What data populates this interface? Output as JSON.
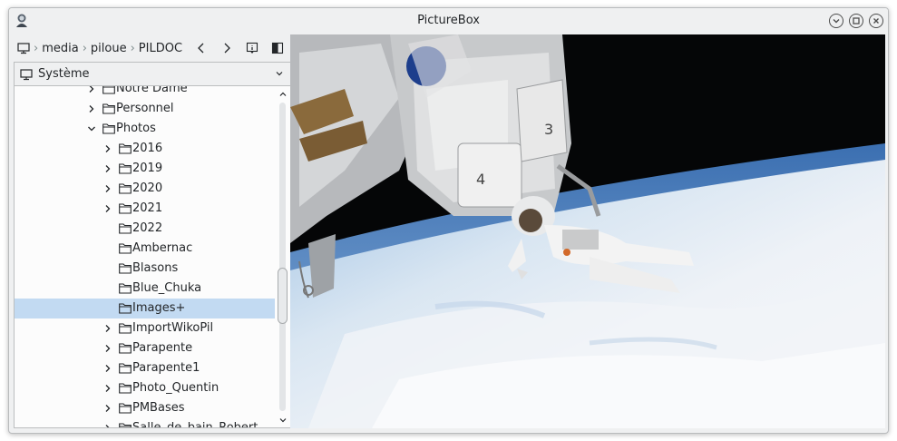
{
  "window": {
    "title": "PictureBox"
  },
  "icons": {
    "app": "astronaut-app-icon",
    "minimize": "chevron-down-icon",
    "maximize": "square-icon",
    "close": "x-icon"
  },
  "pathbar": {
    "crumbs": [
      "media",
      "piloue",
      "PILDOC"
    ],
    "back_icon": "chevron-left-icon",
    "forward_icon": "chevron-right-icon",
    "info_icon": "info-icon",
    "columns_icon": "two-columns-icon"
  },
  "location": {
    "label": "Système"
  },
  "tree": {
    "items": [
      {
        "label": "Notre Dame",
        "arrow": "right"
      },
      {
        "label": "Personnel",
        "arrow": "right"
      },
      {
        "label": "Photos",
        "arrow": "down"
      },
      {
        "label": "2016",
        "arrow": "right"
      },
      {
        "label": "2019",
        "arrow": "right"
      },
      {
        "label": "2020",
        "arrow": "right"
      },
      {
        "label": "2021",
        "arrow": "right"
      },
      {
        "label": "2022",
        "arrow": "none"
      },
      {
        "label": "Ambernac",
        "arrow": "none"
      },
      {
        "label": "Blasons",
        "arrow": "none"
      },
      {
        "label": "Blue_Chuka",
        "arrow": "none"
      },
      {
        "label": "Images+",
        "arrow": "none",
        "selected": true
      },
      {
        "label": "ImportWikoPil",
        "arrow": "right"
      },
      {
        "label": "Parapente",
        "arrow": "right"
      },
      {
        "label": "Parapente1",
        "arrow": "right"
      },
      {
        "label": "Photo_Quentin",
        "arrow": "right"
      },
      {
        "label": "PMBases",
        "arrow": "right"
      },
      {
        "label": "Salle_de_bain_Robert",
        "arrow": "right"
      }
    ]
  },
  "colors": {
    "selection": "#c2daf2",
    "window_bg": "#eff0f1",
    "space": "#050607",
    "earth_cloud": "#eef2f7",
    "earth_blue": "#3b6fb1"
  }
}
